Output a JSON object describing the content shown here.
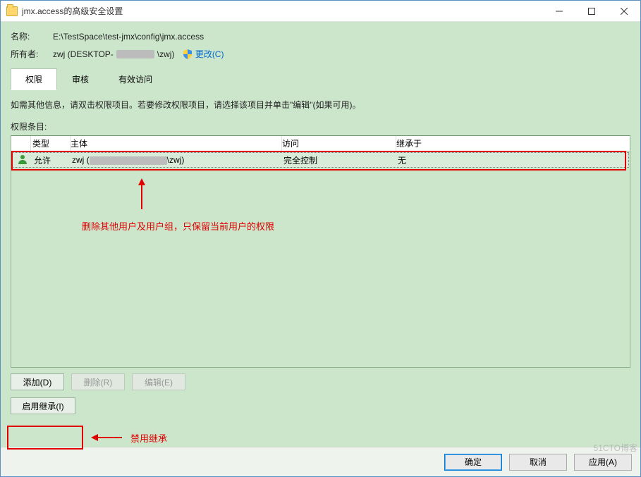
{
  "window": {
    "title": "jmx.access的高级安全设置"
  },
  "header": {
    "name_label": "名称:",
    "name_value": "E:\\TestSpace\\test-jmx\\config\\jmx.access",
    "owner_label": "所有者:",
    "owner_value_prefix": "zwj (DESKTOP-",
    "owner_value_suffix": "\\zwj)",
    "change_link": "更改(C)"
  },
  "tabs": [
    {
      "label": "权限",
      "active": true
    },
    {
      "label": "审核",
      "active": false
    },
    {
      "label": "有效访问",
      "active": false
    }
  ],
  "instruction": "如需其他信息，请双击权限项目。若要修改权限项目，请选择该项目并单击\"编辑\"(如果可用)。",
  "list_label": "权限条目:",
  "columns": {
    "type": "类型",
    "principal": "主体",
    "access": "访问",
    "inherit": "继承于"
  },
  "rows": [
    {
      "type": "允许",
      "principal_prefix": "zwj (",
      "principal_suffix": "\\zwj)",
      "access": "完全控制",
      "inherit": "无"
    }
  ],
  "buttons": {
    "add": "添加(D)",
    "remove": "删除(R)",
    "edit": "编辑(E)",
    "enable_inherit": "启用继承(I)"
  },
  "footer": {
    "ok": "确定",
    "cancel": "取消",
    "apply": "应用(A)"
  },
  "annotations": {
    "row_note": "删除其他用户及用户组，只保留当前用户的权限",
    "inherit_note": "禁用继承"
  },
  "watermark": "51CTO博客"
}
